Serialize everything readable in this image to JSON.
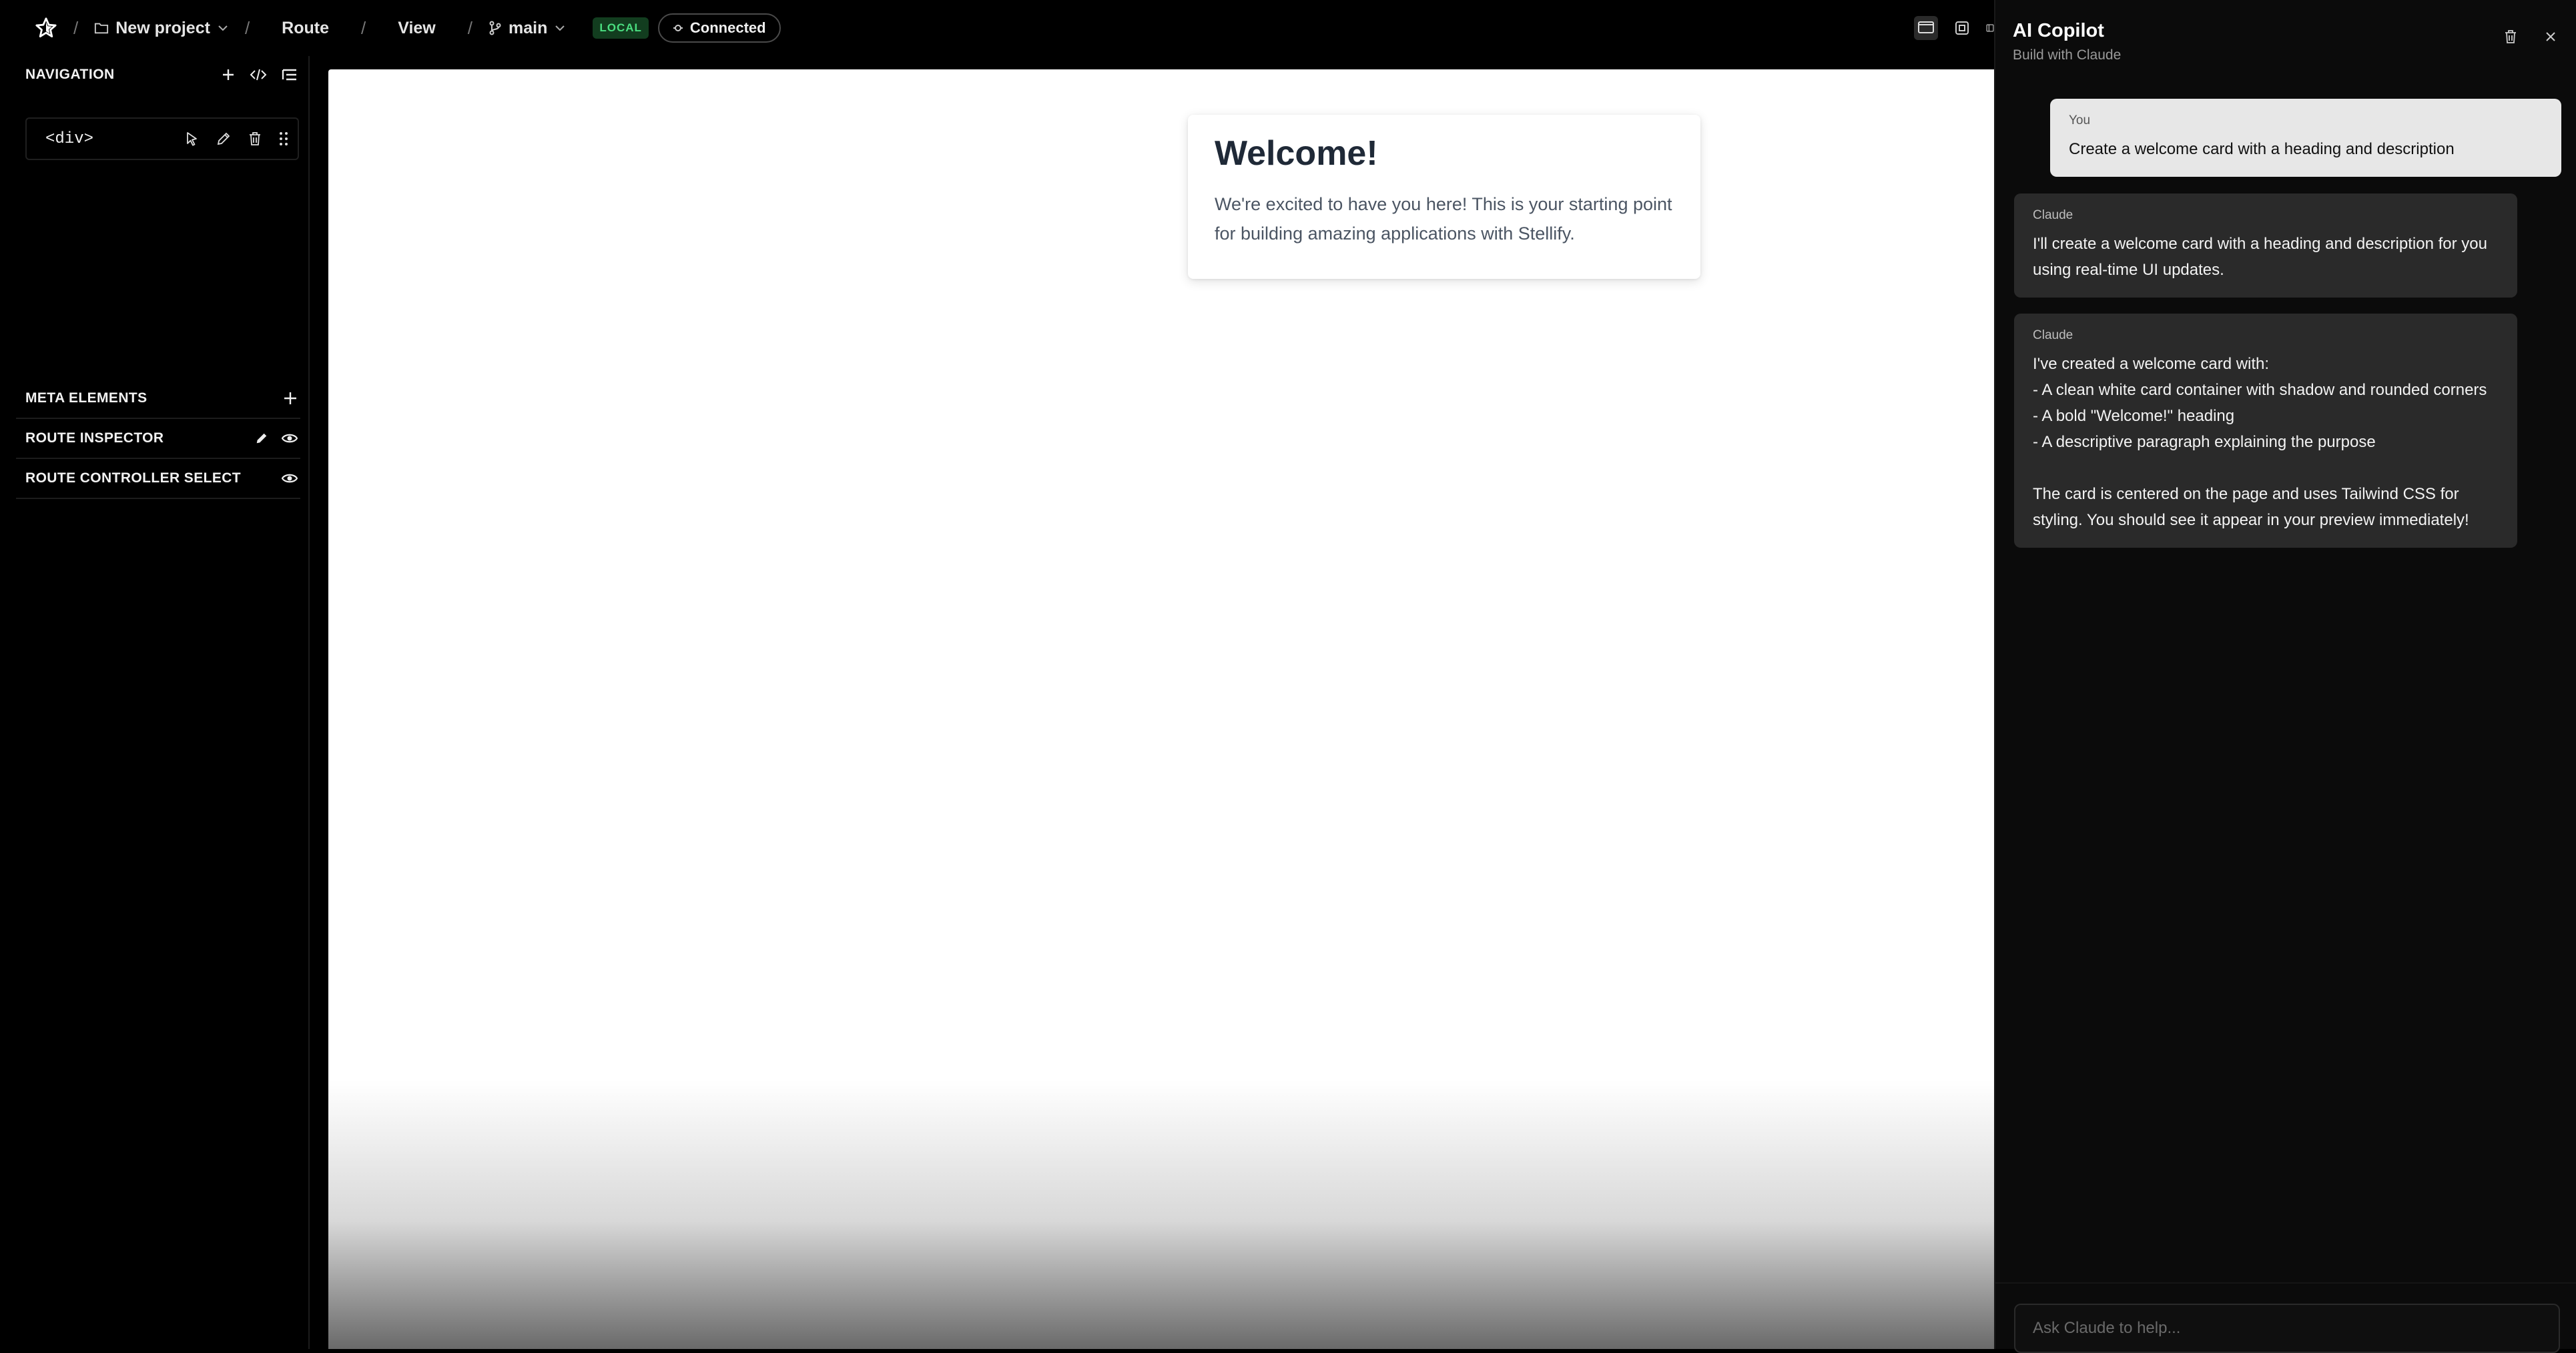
{
  "topbar": {
    "project": "New project",
    "route": "Route",
    "view": "View",
    "branch": "main",
    "env_badge": "LOCAL",
    "status": "Connected",
    "icons": [
      "star-logo-icon",
      "folder-icon",
      "chevron-down-icon",
      "git-branch-icon",
      "plug-icon",
      "desktop-view-icon",
      "fit-view-icon",
      "split-view-icon"
    ]
  },
  "sidebar": {
    "navigation_title": "NAVIGATION",
    "node_tag": "<div>",
    "meta_elements": "META ELEMENTS",
    "route_inspector": "ROUTE INSPECTOR",
    "route_controller_select": "ROUTE CONTROLLER SELECT"
  },
  "canvas": {
    "card_title": "Welcome!",
    "card_body": "We're excited to have you here! This is your starting point for building amazing applications with Stellify."
  },
  "copilot": {
    "title": "AI Copilot",
    "subtitle": "Build with Claude",
    "messages": [
      {
        "who": "You",
        "text": "Create a welcome card with a heading and description"
      },
      {
        "who": "Claude",
        "text": "I'll create a welcome card with a heading and description for you using real-time UI updates."
      },
      {
        "who": "Claude",
        "text": "I've created a welcome card with:\n- A clean white card container with shadow and rounded corners\n- A bold \"Welcome!\" heading\n- A descriptive paragraph explaining the purpose\n\nThe card is centered on the page and uses Tailwind CSS for styling. You should see it appear in your preview immediately!"
      }
    ],
    "input_placeholder": "Ask Claude to help..."
  },
  "colors": {
    "badge_bg": "#123d1f",
    "badge_text": "#4ade80",
    "user_bubble": "#e7e7e7",
    "ai_bubble": "#2a2a2a"
  }
}
